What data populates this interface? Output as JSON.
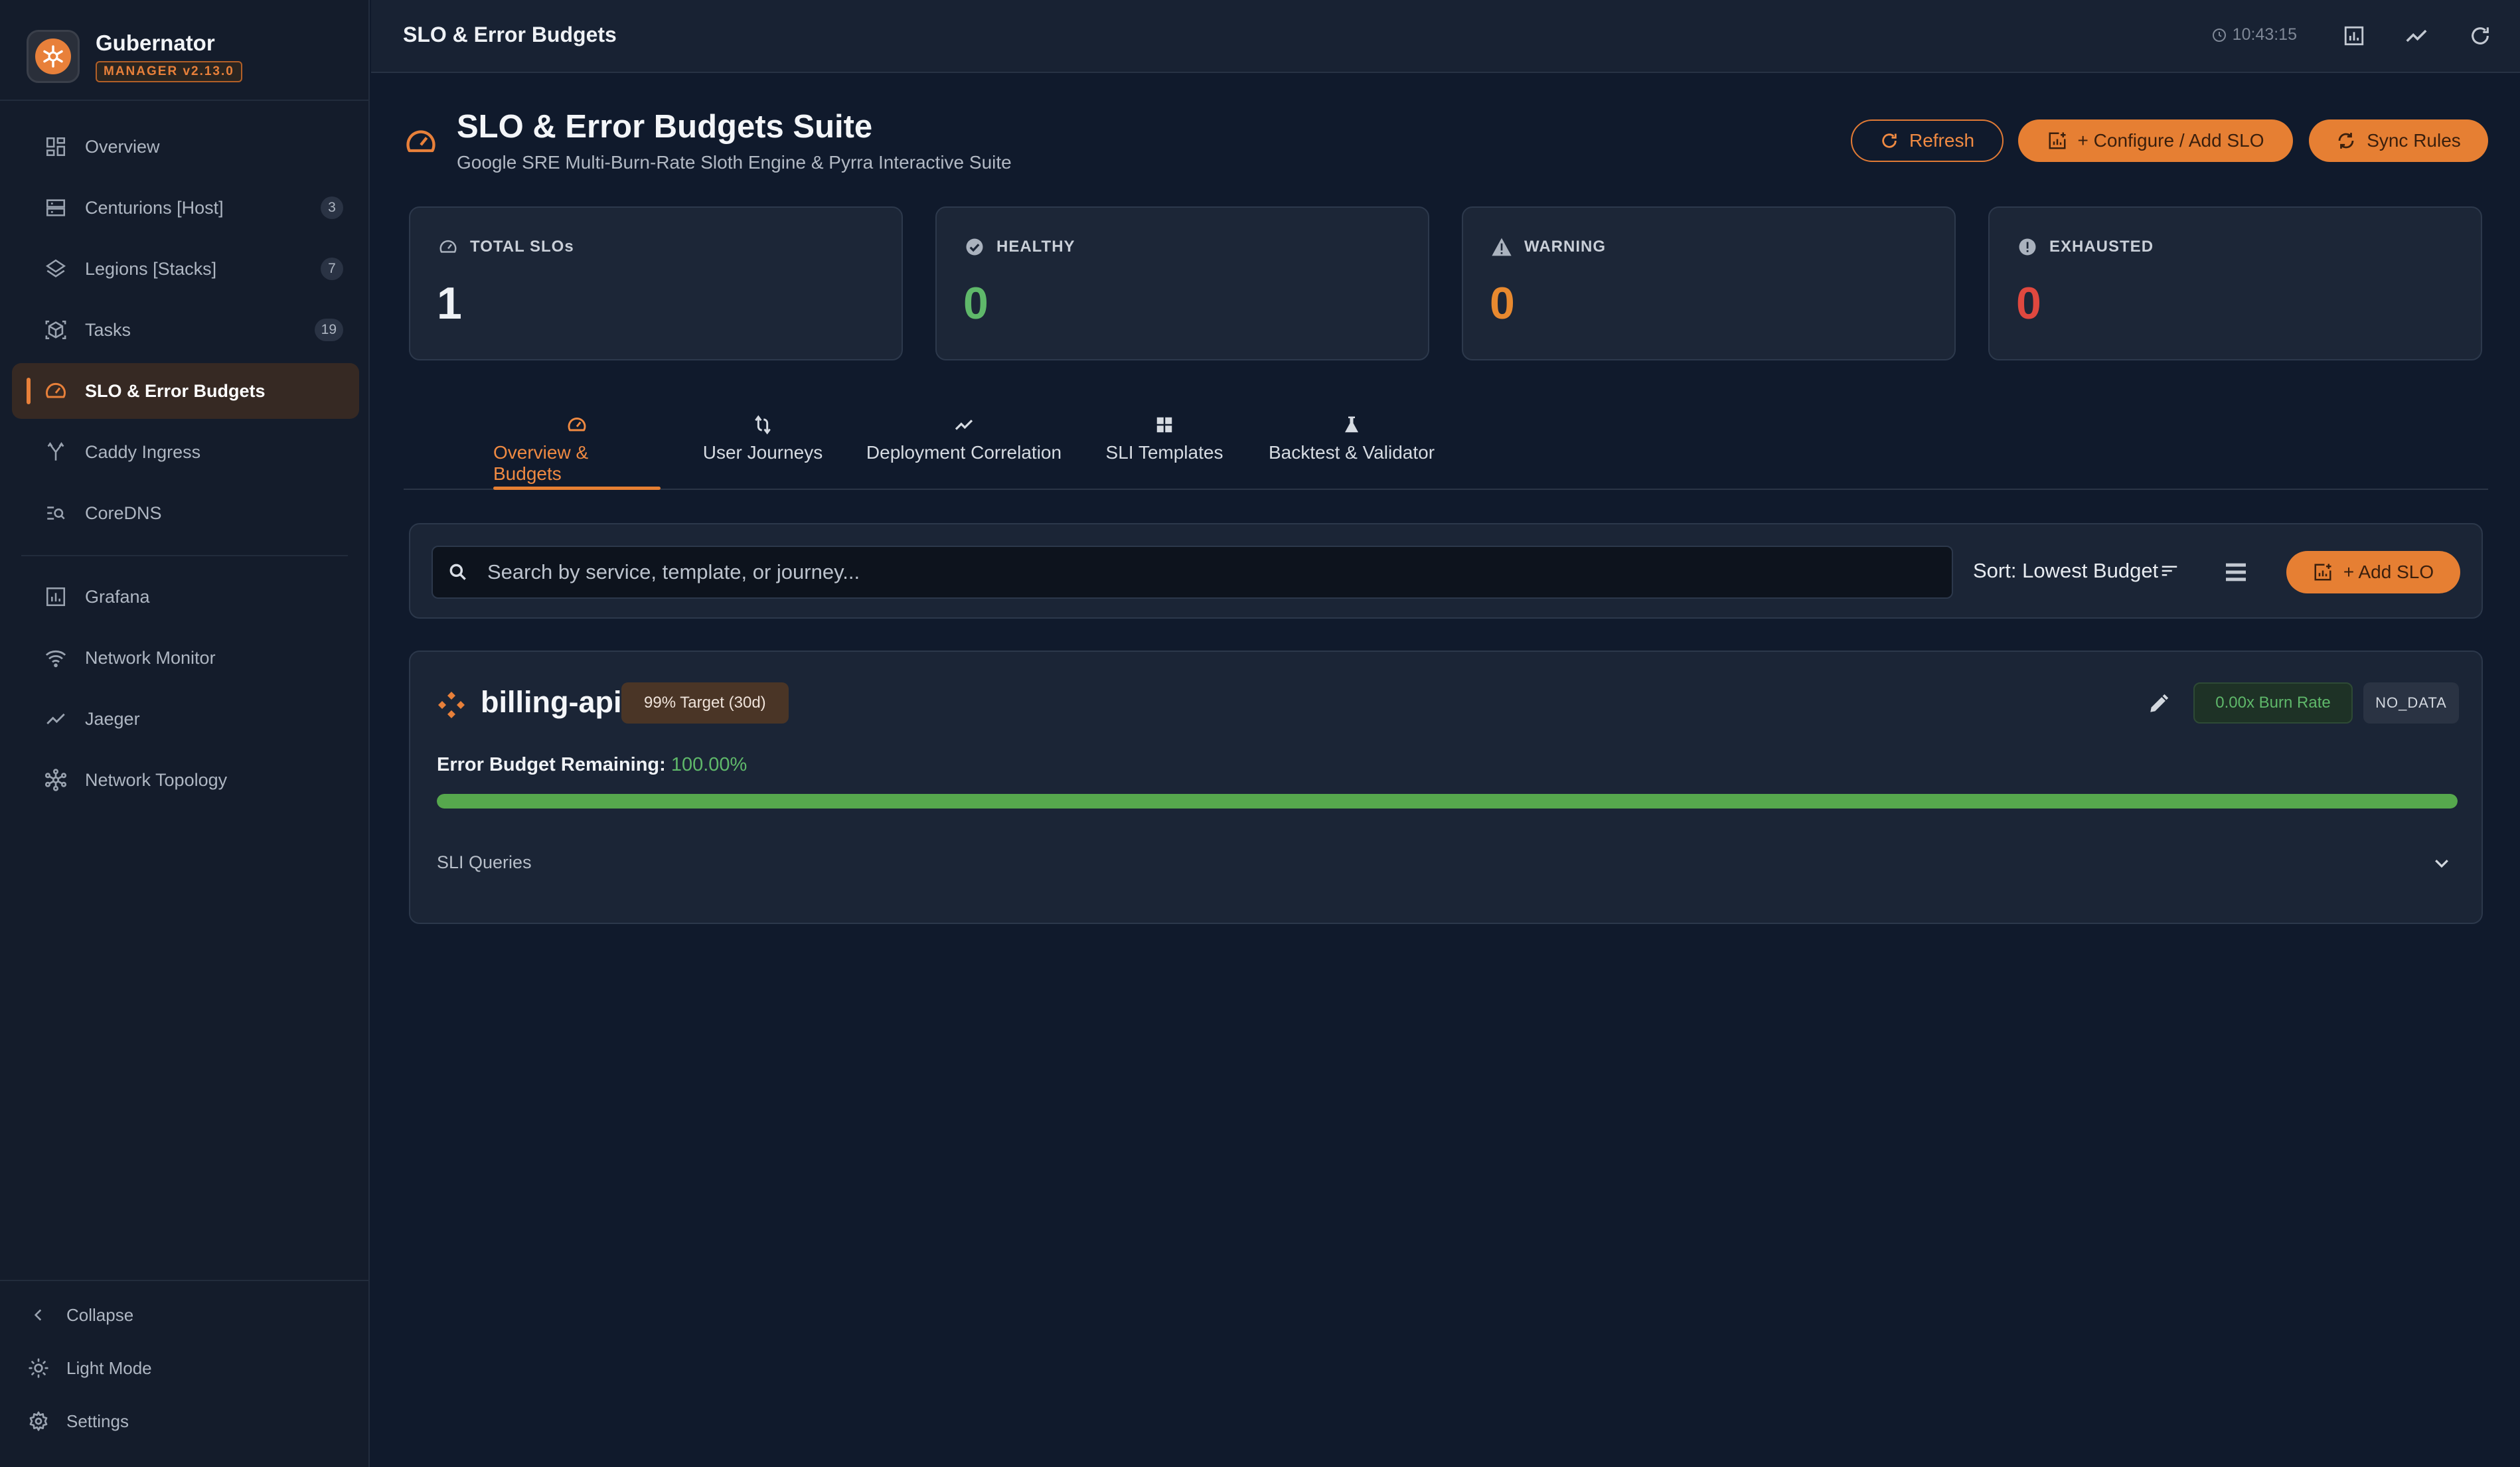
{
  "app": {
    "name": "Gubernator",
    "version_badge": "MANAGER v2.13.0"
  },
  "sidebar": {
    "items": [
      {
        "label": "Overview",
        "icon": "grid-icon",
        "count": ""
      },
      {
        "label": "Centurions [Host]",
        "icon": "server-icon",
        "count": "3"
      },
      {
        "label": "Legions [Stacks]",
        "icon": "layers-icon",
        "count": "7"
      },
      {
        "label": "Tasks",
        "icon": "cube-icon",
        "count": "19"
      },
      {
        "label": "SLO & Error Budgets",
        "icon": "speedometer-icon",
        "count": "",
        "active": true
      },
      {
        "label": "Caddy Ingress",
        "icon": "fork-icon",
        "count": ""
      },
      {
        "label": "CoreDNS",
        "icon": "dns-search-icon",
        "count": ""
      },
      {
        "label": "Grafana",
        "icon": "chart-box-icon",
        "count": ""
      },
      {
        "label": "Network Monitor",
        "icon": "wifi-icon",
        "count": ""
      },
      {
        "label": "Jaeger",
        "icon": "trend-icon",
        "count": ""
      },
      {
        "label": "Network Topology",
        "icon": "hub-icon",
        "count": ""
      }
    ],
    "footer": {
      "collapse": "Collapse",
      "light_mode": "Light Mode",
      "settings": "Settings"
    }
  },
  "topbar": {
    "title": "SLO & Error Budgets",
    "time": "10:43:15"
  },
  "header": {
    "title": "SLO & Error Budgets Suite",
    "subtitle": "Google SRE Multi-Burn-Rate Sloth Engine & Pyrra Interactive Suite",
    "refresh_label": "Refresh",
    "configure_label": "+ Configure / Add SLO",
    "sync_label": "Sync Rules"
  },
  "stats": [
    {
      "label": "TOTAL SLOs",
      "value": "1",
      "color": "#eef1f5"
    },
    {
      "label": "HEALTHY",
      "value": "0",
      "color": "#5fb86a"
    },
    {
      "label": "WARNING",
      "value": "0",
      "color": "#e8892f"
    },
    {
      "label": "EXHAUSTED",
      "value": "0",
      "color": "#e0483f"
    }
  ],
  "tabs": [
    {
      "label": "Overview & Budgets",
      "active": true
    },
    {
      "label": "User Journeys"
    },
    {
      "label": "Deployment Correlation"
    },
    {
      "label": "SLI Templates"
    },
    {
      "label": "Backtest & Validator"
    }
  ],
  "search": {
    "placeholder": "Search by service, template, or journey...",
    "sort_label": "Sort: Lowest Budget",
    "add_label": "+ Add SLO"
  },
  "slo": {
    "name": "billing-api",
    "target": "99% Target (30d)",
    "burn_rate": "0.00x Burn Rate",
    "status": "NO_DATA",
    "budget_label": "Error Budget Remaining:",
    "budget_value": "100.00%",
    "budget_fraction": 1.0,
    "sli_label": "SLI Queries"
  },
  "colors": {
    "accent": "#e67f33",
    "healthy": "#5fb86a",
    "warning": "#e8892f",
    "exhausted": "#e0483f"
  }
}
